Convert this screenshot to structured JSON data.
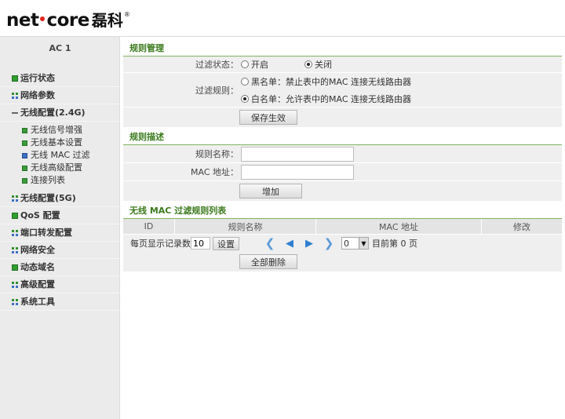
{
  "brand": {
    "name_latin": "net",
    "name_latin2": "core",
    "name_cn": "磊科",
    "registered": "®"
  },
  "sidebar": {
    "title": "AC 1",
    "items": [
      {
        "label": "运行状态",
        "icon": "green-square-icon"
      },
      {
        "label": "网络参数",
        "icon": "grid-icon"
      },
      {
        "label": "无线配置(2.4G)",
        "icon": "minus-icon",
        "children": [
          {
            "label": "无线信号增强"
          },
          {
            "label": "无线基本设置"
          },
          {
            "label": "无线 MAC 过滤"
          },
          {
            "label": "无线高级配置"
          },
          {
            "label": "连接列表"
          }
        ]
      },
      {
        "label": "无线配置(5G)",
        "icon": "grid-icon"
      },
      {
        "label": "QoS 配置",
        "icon": "green-square-icon"
      },
      {
        "label": "端口转发配置",
        "icon": "grid-icon"
      },
      {
        "label": "网络安全",
        "icon": "grid-icon"
      },
      {
        "label": "动态域名",
        "icon": "green-square-icon"
      },
      {
        "label": "高级配置",
        "icon": "grid-icon"
      },
      {
        "label": "系统工具",
        "icon": "grid-icon"
      }
    ]
  },
  "rule_mgmt": {
    "title": "规则管理",
    "status_label": "过滤状态：",
    "status_on": "开启",
    "status_off": "关闭",
    "status_selected": "关闭",
    "rule_label": "过滤规则：",
    "blacklist": "黑名单：禁止表中的MAC 连接无线路由器",
    "whitelist": "白名单：允许表中的MAC 连接无线路由器",
    "rule_selected": "白名单",
    "save_button": "保存生效"
  },
  "rule_desc": {
    "title": "规则描述",
    "name_label": "规则名称：",
    "name_value": "",
    "mac_label": "MAC 地址：",
    "mac_value": "",
    "add_button": "增加"
  },
  "rule_list": {
    "title": "无线 MAC 过滤规则列表",
    "columns": [
      "ID",
      "规则名称",
      "MAC 地址",
      "修改"
    ],
    "rows": [],
    "per_page_label": "每页显示记录数",
    "per_page_value": "10",
    "set_button": "设置",
    "page_select": "0",
    "current_page_text": "目前第 0 页",
    "delete_all_button": "全部删除"
  }
}
